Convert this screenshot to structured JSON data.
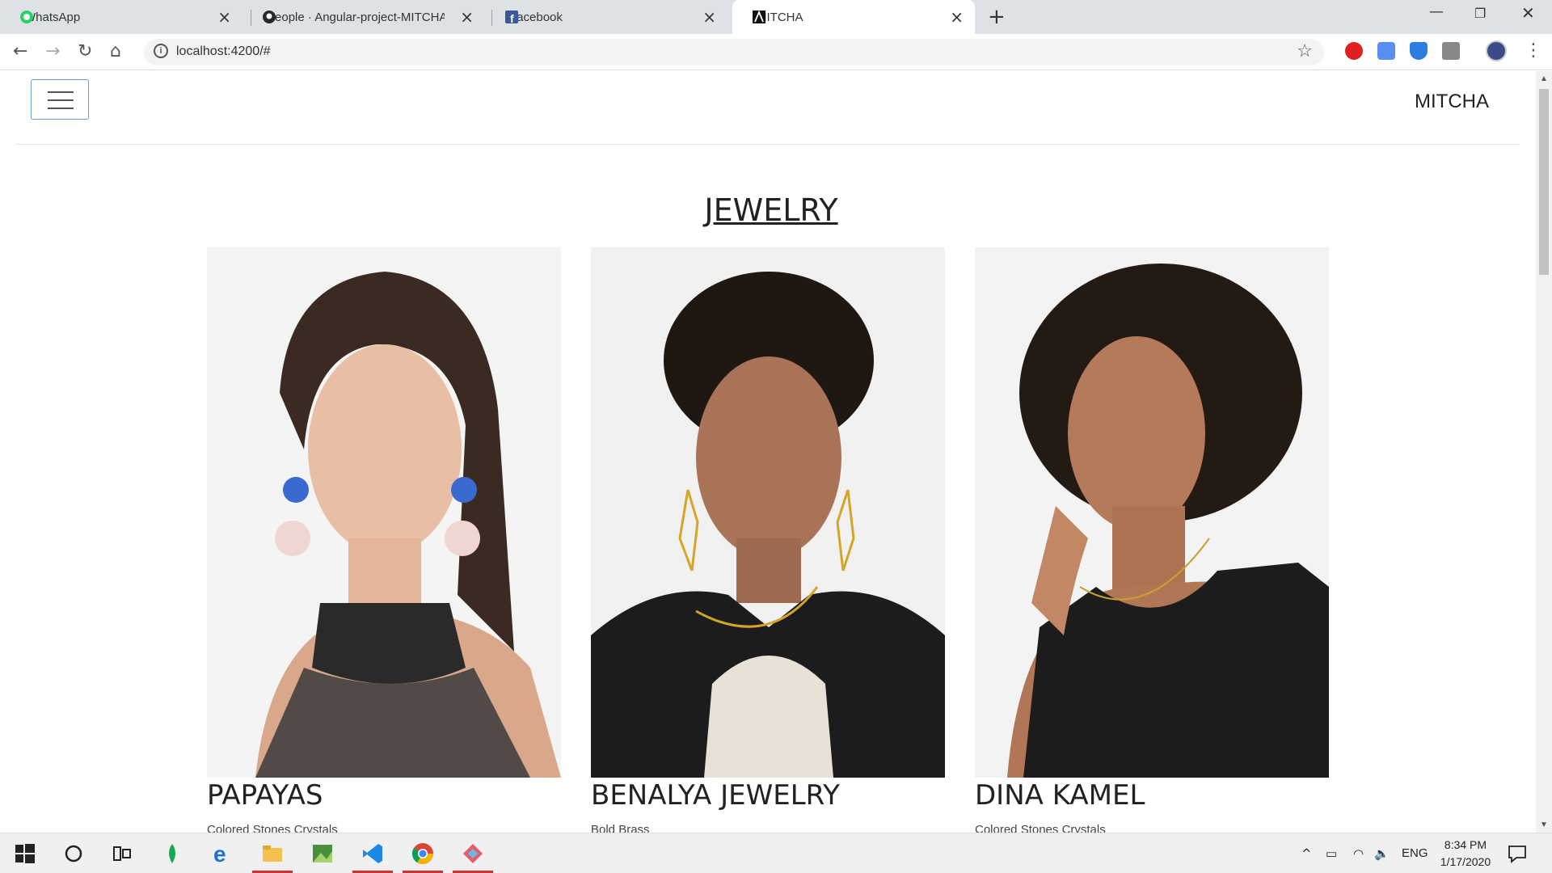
{
  "browser": {
    "tabs": [
      {
        "title": "WhatsApp",
        "icon": "whatsapp-icon",
        "active": false
      },
      {
        "title": "People · Angular-project-MITCHA",
        "icon": "github-icon",
        "active": false
      },
      {
        "title": "Facebook",
        "icon": "facebook-icon",
        "active": false
      },
      {
        "title": "MITCHA",
        "icon": "mitcha-icon",
        "active": true
      }
    ],
    "url": "localhost:4200/#"
  },
  "site": {
    "brand": "MITCHA",
    "section_title": "JEWELRY",
    "cards": [
      {
        "name": "PAPAYAS",
        "subtitle": "Colored Stones Crystals"
      },
      {
        "name": "BENALYA JEWELRY",
        "subtitle": "Bold Brass"
      },
      {
        "name": "DINA KAMEL",
        "subtitle": "Colored Stones Crystals"
      }
    ]
  },
  "taskbar": {
    "language": "ENG",
    "time": "8:34 PM",
    "date": "1/17/2020"
  },
  "colors": {
    "tabstrip": "#dee1e6",
    "accent_underline": "#d03030",
    "toggle_border": "#6a9cd8"
  }
}
